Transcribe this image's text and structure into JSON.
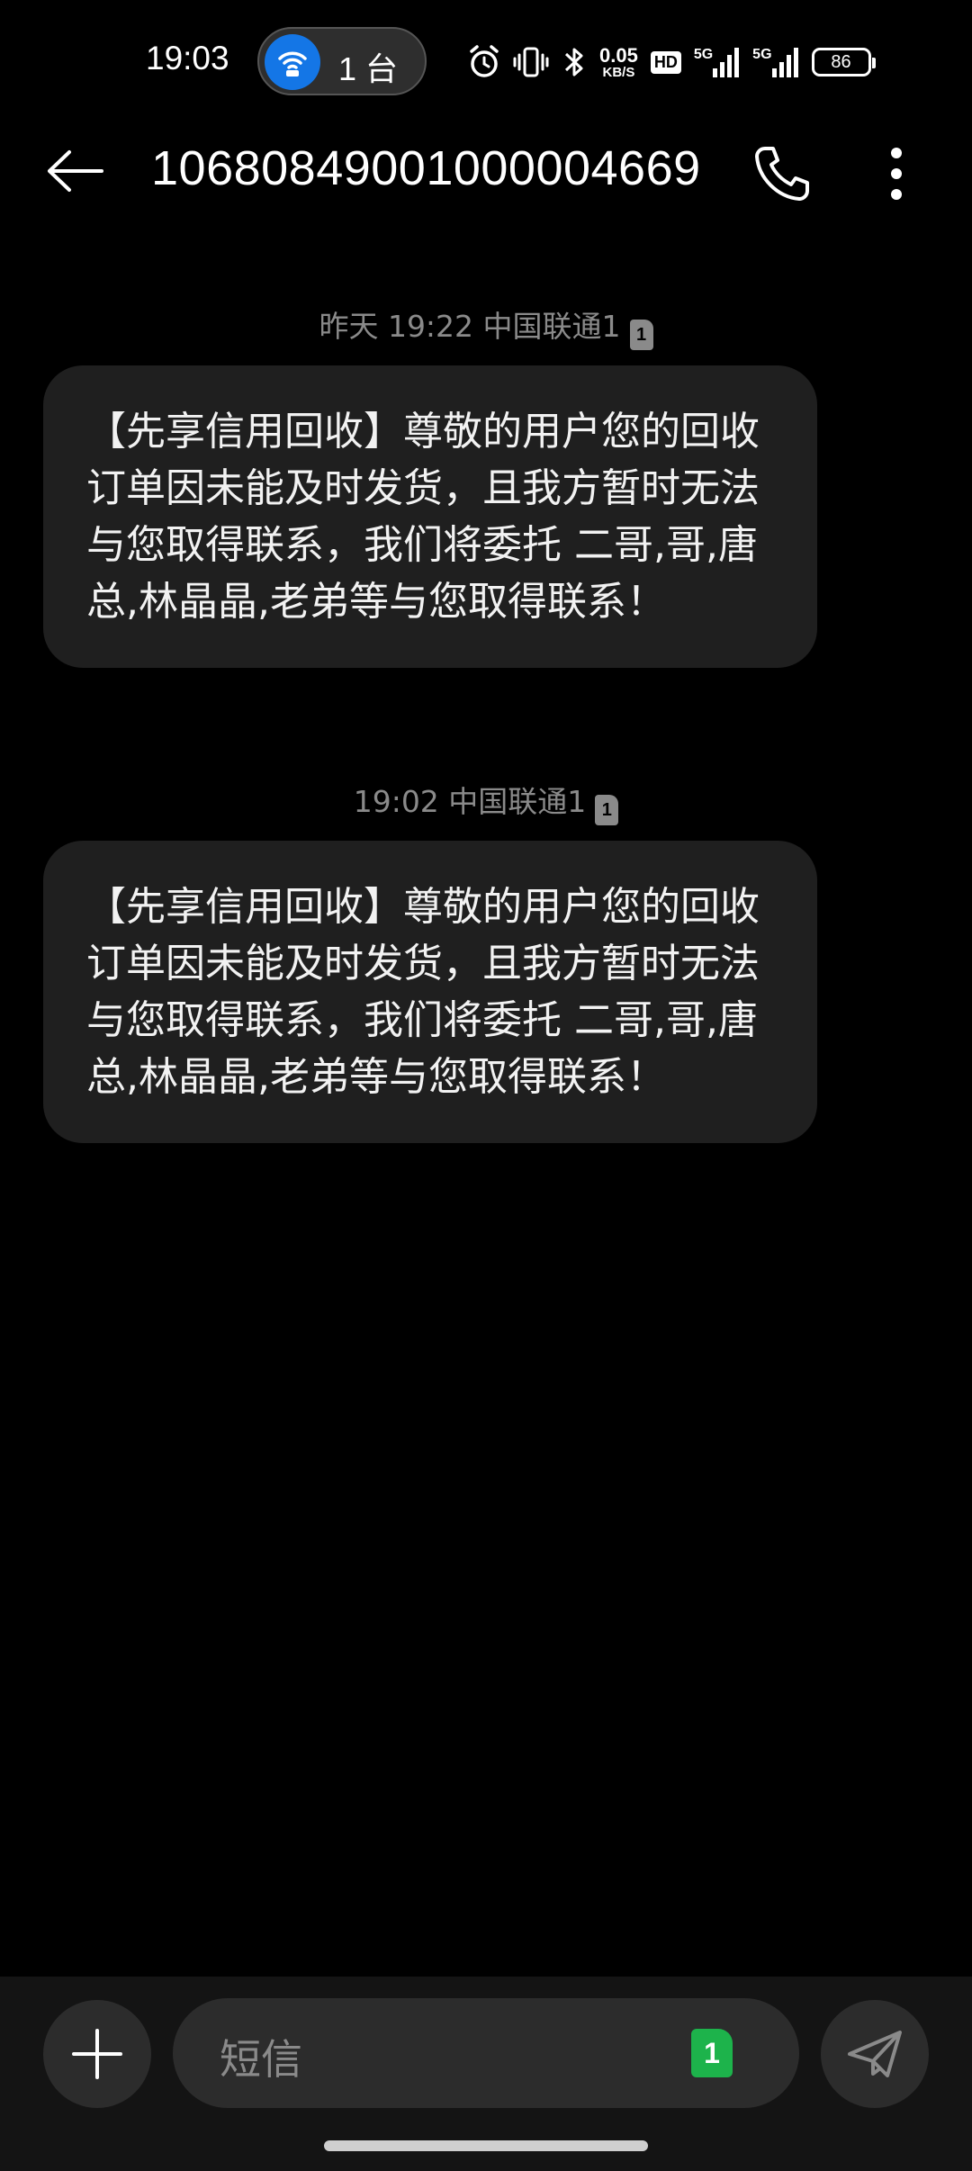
{
  "status_bar": {
    "time": "19:03",
    "hotspot_count": "1 台",
    "net_speed_value": "0.05",
    "net_speed_unit": "KB/S",
    "hd_label": "HD",
    "signal_1_label": "5G",
    "signal_2_label": "5G",
    "battery": "86",
    "icons": [
      "hotspot-icon",
      "alarm-icon",
      "vibrate-icon",
      "bluetooth-icon",
      "signal-icon",
      "battery-icon"
    ]
  },
  "header": {
    "title": "10680849001000004669",
    "icons": [
      "back-arrow-icon",
      "phone-icon",
      "more-vertical-icon"
    ]
  },
  "messages": [
    {
      "meta": "昨天 19:22 中国联通1",
      "sim": "1",
      "text": "【先享信用回收】尊敬的用户您的回收订单因未能及时发货，且我方暂时无法与您取得联系，我们将委托 二哥,哥,唐总,林晶晶,老弟等与您取得联系！"
    },
    {
      "meta": "19:02 中国联通1",
      "sim": "1",
      "text": "【先享信用回收】尊敬的用户您的回收订单因未能及时发货，且我方暂时无法与您取得联系，我们将委托 二哥,哥,唐总,林晶晶,老弟等与您取得联系！"
    }
  ],
  "compose": {
    "placeholder": "短信",
    "sim_badge": "1",
    "icons": [
      "plus-icon",
      "send-icon"
    ]
  },
  "colors": {
    "background": "#000000",
    "bubble": "#1f1f1f",
    "meta_text": "#8a8a8a",
    "hotspot_blue": "#1476e6",
    "sim_green": "#1db34b"
  }
}
